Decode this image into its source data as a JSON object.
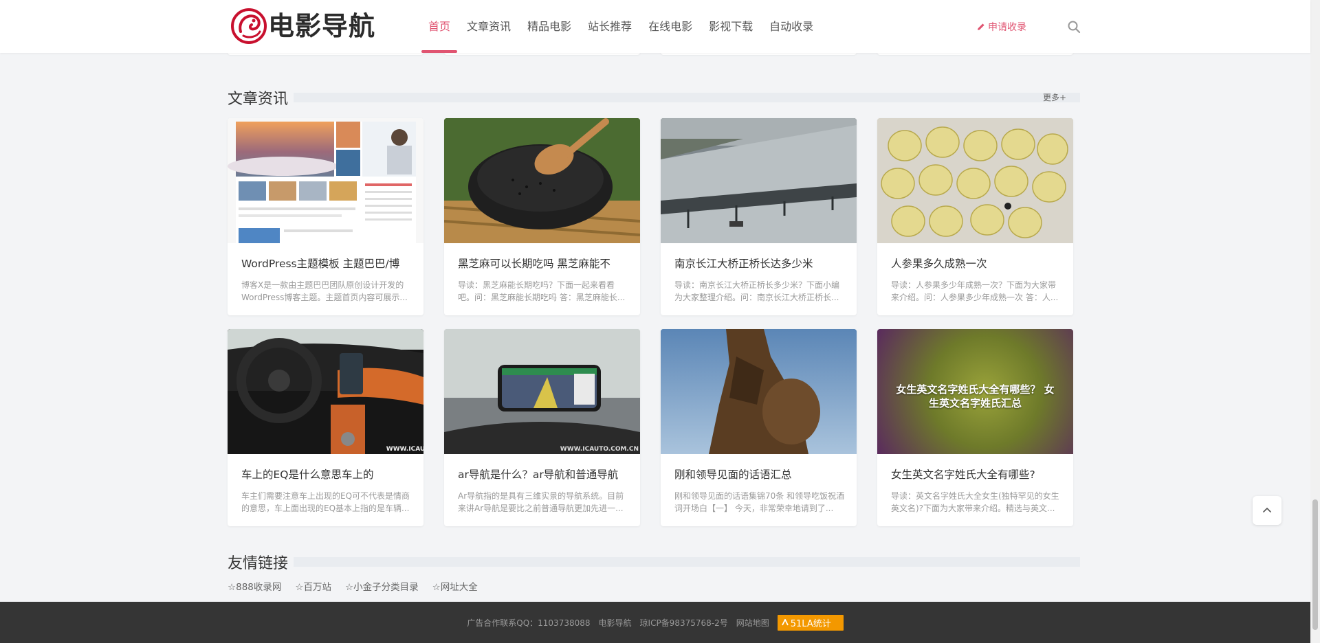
{
  "header": {
    "logo_text": "电影导航",
    "nav": [
      {
        "label": "首页",
        "active": true
      },
      {
        "label": "文章资讯",
        "active": false
      },
      {
        "label": "精品电影",
        "active": false
      },
      {
        "label": "站长推荐",
        "active": false
      },
      {
        "label": "在线电影",
        "active": false
      },
      {
        "label": "影视下载",
        "active": false
      },
      {
        "label": "自动收录",
        "active": false
      }
    ],
    "apply_label": "申请收录"
  },
  "articles": {
    "title": "文章资讯",
    "more_label": "更多+",
    "cards": [
      {
        "title": "WordPress主题模板 主题巴巴/博",
        "desc": "博客X是一款由主题巴巴团队原创设计开发的WordPress博客主题。主题首页内容可展示..."
      },
      {
        "title": "黑芝麻可以长期吃吗 黑芝麻能不",
        "desc": "导读：黑芝麻能长期吃吗？下面一起来看看吧。问：黑芝麻能长期吃吗 答：黑芝麻能长..."
      },
      {
        "title": "南京长江大桥正桥长达多少米",
        "desc": "导读：南京长江大桥正桥长多少米？下面小编为大家整理介绍。问：南京长江大桥正桥长..."
      },
      {
        "title": "人参果多久成熟一次",
        "desc": "导读：人参果多少年成熟一次？下面为大家带来介绍。问：人参果多少年成熟一次 答：人..."
      },
      {
        "title": "车上的EQ是什么意思车上的",
        "desc": "车主们需要注意车上出现的EQ可不代表是情商的意思，车上面出现的EQ基本上指的是车辆..."
      },
      {
        "title": "ar导航是什么？ar导航和普通导航",
        "desc": "Ar导航指的是具有三维实景的导航系统。目前来讲Ar导航是要比之前普通导航更加先进一..."
      },
      {
        "title": "刚和领导见面的话语汇总",
        "desc": "刚和领导见面的话语集锦70条 和领导吃饭祝酒词开场白【一】 今天，非常荣幸地请到了..."
      },
      {
        "title": "女生英文名字姓氏大全有哪些?",
        "desc": "导读：英文名字姓氏大全女生(独特罕见的女生英文名)?下面为大家带来介绍。精选与英文..."
      }
    ],
    "card8_overlay": "女生英文名字姓氏大全有哪些？ 女生英文名字姓氏汇总",
    "card5_watermark": "WWW.ICAUTO.COM.CN",
    "card6_watermark": "WWW.ICAUTO.COM.CN"
  },
  "friends": {
    "title": "友情链接",
    "links": [
      "☆888收录网",
      "☆百万站",
      "☆小金子分类目录",
      "☆网址大全"
    ]
  },
  "footer": {
    "contact": "广告合作联系QQ：1103738088",
    "site_name": "电影导航",
    "icp": "琼ICP备98375768-2号",
    "sitemap": "网站地图",
    "stat_label": "51LA统计"
  },
  "colors": {
    "accent": "#e05471",
    "footer_bg": "#353535",
    "page_bg": "#f3f4f6",
    "stat_badge": "#f39800"
  },
  "icons": {
    "search": "search-icon",
    "back_to_top": "chevron-up-icon",
    "apply": "pencil-icon"
  }
}
